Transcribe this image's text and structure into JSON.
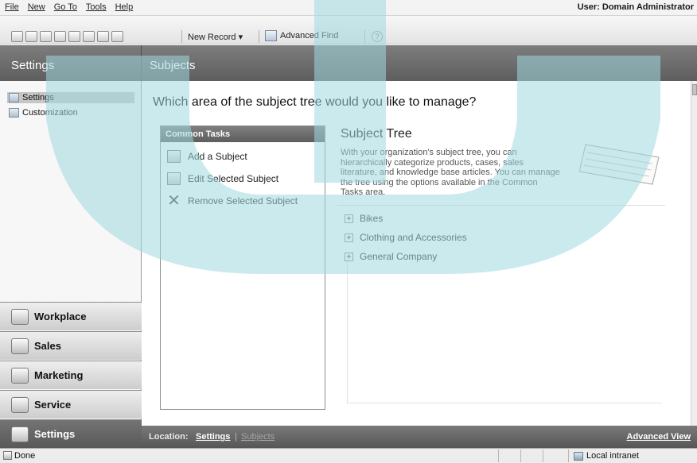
{
  "menubar": {
    "items": [
      "File",
      "New",
      "Go To",
      "Tools",
      "Help"
    ],
    "user": "User: Domain Administrator"
  },
  "toolbar": {
    "new_record": "New Record ▾",
    "advanced_find": "Advanced Find",
    "icons": [
      "new-icon",
      "refresh-icon",
      "back-icon",
      "mail-icon",
      "document-icon",
      "report-icon",
      "calendar-icon",
      "user-icon"
    ]
  },
  "header": {
    "left_title": "Settings",
    "right_title": "Subjects"
  },
  "nav": {
    "items": [
      {
        "label": "Settings",
        "icon": "settings-icon",
        "selected": true
      },
      {
        "label": "Customization",
        "icon": "customization-icon",
        "selected": false
      }
    ],
    "wunderbar": [
      {
        "label": "Workplace",
        "icon": "workplace-icon",
        "active": false
      },
      {
        "label": "Sales",
        "icon": "sales-icon",
        "active": false
      },
      {
        "label": "Marketing",
        "icon": "marketing-icon",
        "active": false
      },
      {
        "label": "Service",
        "icon": "service-icon",
        "active": false
      },
      {
        "label": "Settings",
        "icon": "settings-icon",
        "active": true
      }
    ]
  },
  "main": {
    "question": "Which area of the subject tree would you like to manage?",
    "tasks": {
      "title": "Common Tasks",
      "items": [
        {
          "label": "Add a Subject",
          "icon": "add-subject-icon"
        },
        {
          "label": "Edit Selected Subject",
          "icon": "edit-subject-icon"
        },
        {
          "label": "Remove Selected Subject",
          "icon": "remove-x-icon"
        }
      ]
    },
    "subject_tree": {
      "title": "Subject Tree",
      "description": "With your organization's subject tree, you can hierarchically categorize products, cases, sales literature, and knowledge base articles. You can manage the tree using the options available in the Common Tasks area.",
      "nodes": [
        "Bikes",
        "Clothing and Accessories",
        "General Company"
      ]
    }
  },
  "location": {
    "label": "Location:",
    "value": "Settings",
    "separator": "|",
    "value2": "Subjects",
    "advanced_view": "Advanced View"
  },
  "status": {
    "text": "Done",
    "zone": "Local intranet"
  },
  "colors": {
    "watermark": "#a8dde3",
    "header": "#6b6b6b"
  }
}
